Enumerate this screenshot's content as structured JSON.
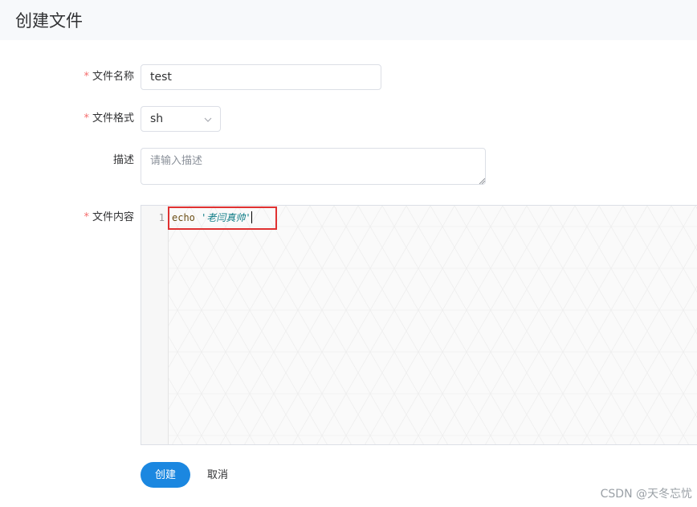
{
  "page": {
    "title": "创建文件"
  },
  "form": {
    "required_mark": "*",
    "name": {
      "label": "文件名称",
      "value": "test"
    },
    "format": {
      "label": "文件格式",
      "value": "sh"
    },
    "description": {
      "label": "描述",
      "placeholder": "请输入描述"
    },
    "content": {
      "label": "文件内容",
      "lines": [
        {
          "number": "1",
          "keyword": "echo",
          "string": "'老闫真帅'"
        }
      ]
    }
  },
  "actions": {
    "create_label": "创建",
    "cancel_label": "取消"
  },
  "watermark": "CSDN @天冬忘忧",
  "colors": {
    "primary": "#1b87e0",
    "required": "#f56c6c",
    "highlight_box": "#e03131",
    "keyword": "#6b4e16",
    "string": "#0e7c86"
  }
}
